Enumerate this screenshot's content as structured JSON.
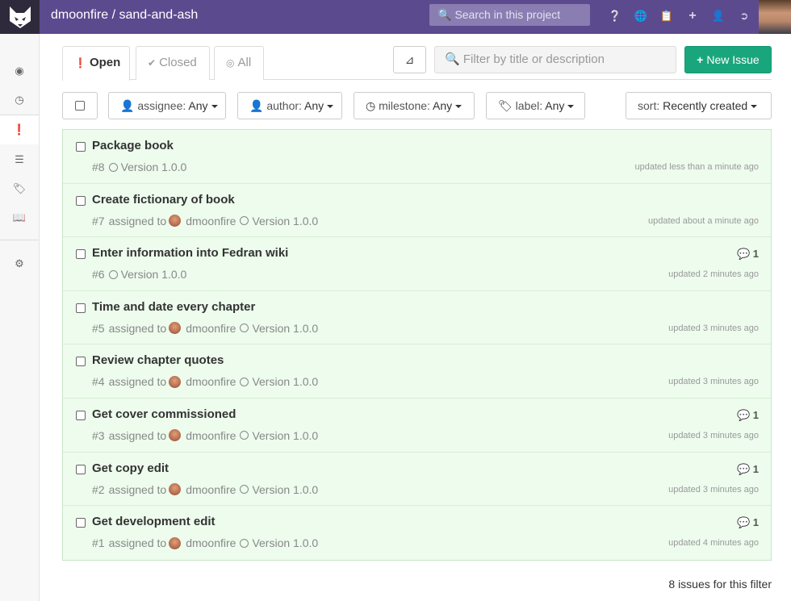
{
  "header": {
    "project_title": "dmoonfire / sand-and-ash",
    "search_placeholder": "Search in this project",
    "icons": [
      "help-icon",
      "globe-icon",
      "snippets-icon",
      "plus-icon",
      "user-icon",
      "sign-out-icon"
    ]
  },
  "sidebar": {
    "items": [
      {
        "icon": "dashboard-icon"
      },
      {
        "icon": "history-icon"
      },
      {
        "icon": "issues-icon",
        "active": true
      },
      {
        "icon": "milestones-icon"
      },
      {
        "icon": "labels-icon"
      },
      {
        "icon": "wiki-icon"
      },
      {
        "icon": "settings-icon"
      }
    ]
  },
  "tabs": [
    {
      "label": "Open",
      "icon": "exclamation-icon"
    },
    {
      "label": "Closed",
      "icon": "check-icon"
    },
    {
      "label": "All",
      "icon": "compass-icon"
    }
  ],
  "filter": {
    "placeholder": "Filter by title or description",
    "new_issue_label": "New Issue",
    "assignee_key": "assignee:",
    "assignee_value": "Any",
    "author_key": "author:",
    "author_value": "Any",
    "milestone_key": "milestone:",
    "milestone_value": "Any",
    "label_key": "label:",
    "label_value": "Any",
    "sort_key": "sort:",
    "sort_value": "Recently created"
  },
  "issues": [
    {
      "title": "Package book",
      "number": "#8",
      "assigned_text": "",
      "assignee": "",
      "milestone": "Version 1.0.0",
      "updated": "updated less than a minute ago",
      "comments": ""
    },
    {
      "title": "Create fictionary of book",
      "number": "#7",
      "assigned_text": "assigned to",
      "assignee": "dmoonfire",
      "milestone": "Version 1.0.0",
      "updated": "updated about a minute ago",
      "comments": ""
    },
    {
      "title": "Enter information into Fedran wiki",
      "number": "#6",
      "assigned_text": "",
      "assignee": "",
      "milestone": "Version 1.0.0",
      "updated": "updated 2 minutes ago",
      "comments": "1"
    },
    {
      "title": "Time and date every chapter",
      "number": "#5",
      "assigned_text": "assigned to",
      "assignee": "dmoonfire",
      "milestone": "Version 1.0.0",
      "updated": "updated 3 minutes ago",
      "comments": ""
    },
    {
      "title": "Review chapter quotes",
      "number": "#4",
      "assigned_text": "assigned to",
      "assignee": "dmoonfire",
      "milestone": "Version 1.0.0",
      "updated": "updated 3 minutes ago",
      "comments": ""
    },
    {
      "title": "Get cover commissioned",
      "number": "#3",
      "assigned_text": "assigned to",
      "assignee": "dmoonfire",
      "milestone": "Version 1.0.0",
      "updated": "updated 3 minutes ago",
      "comments": "1"
    },
    {
      "title": "Get copy edit",
      "number": "#2",
      "assigned_text": "assigned to",
      "assignee": "dmoonfire",
      "milestone": "Version 1.0.0",
      "updated": "updated 3 minutes ago",
      "comments": "1"
    },
    {
      "title": "Get development edit",
      "number": "#1",
      "assigned_text": "assigned to",
      "assignee": "dmoonfire",
      "milestone": "Version 1.0.0",
      "updated": "updated 4 minutes ago",
      "comments": "1"
    }
  ],
  "footer": {
    "count_text": "8 issues for this filter"
  },
  "colors": {
    "header_bg": "#5c4a8f",
    "new_issue_bg": "#1aa67d",
    "issue_row_bg": "#edfced"
  }
}
